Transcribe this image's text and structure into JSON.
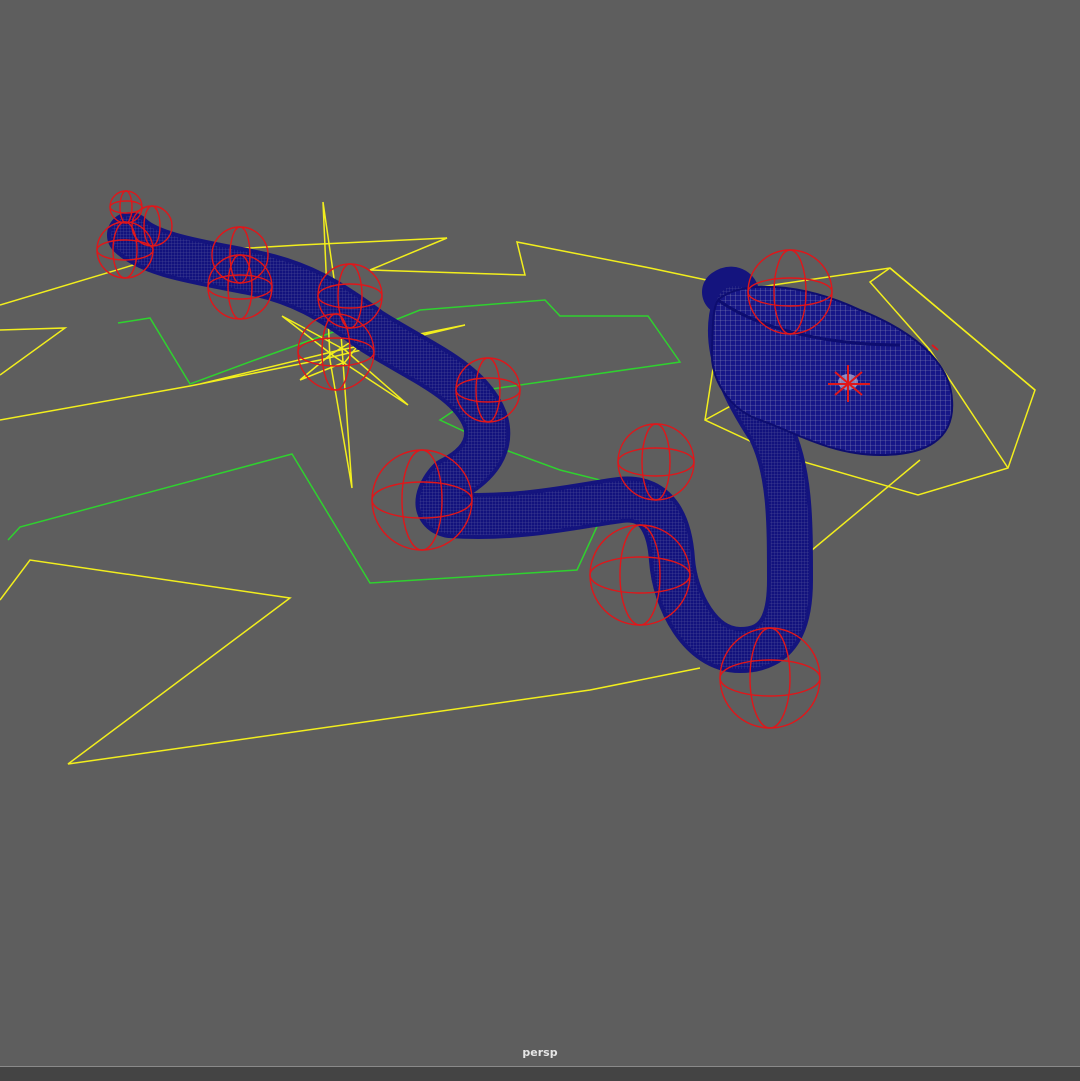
{
  "viewport": {
    "camera_label": "persp",
    "background_color": "#5e5e5e"
  },
  "colors": {
    "mesh_wire": "#0b0b7a",
    "mesh_shade": "#20208a",
    "joint_control": "#e0161a",
    "nurbs_curve_yellow": "#f2ee1d",
    "nurbs_curve_green": "#2fd12f"
  }
}
